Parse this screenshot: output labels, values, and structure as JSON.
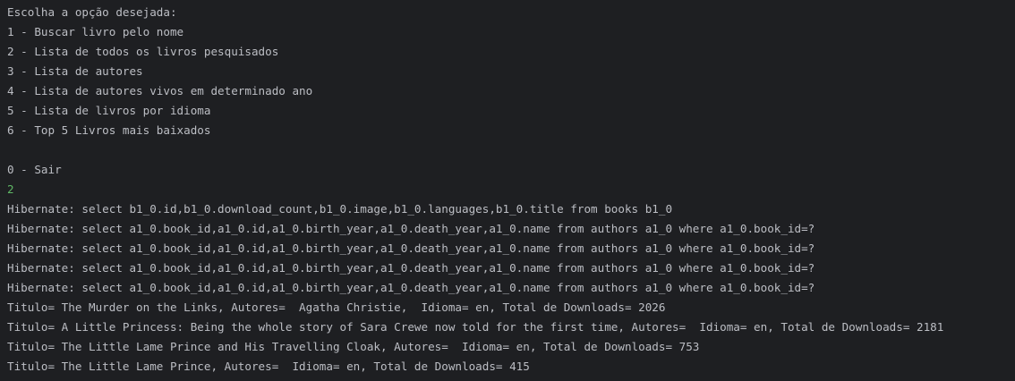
{
  "console": {
    "lines": [
      {
        "text": "Escolha a opção desejada:",
        "kind": "output"
      },
      {
        "text": "1 - Buscar livro pelo nome",
        "kind": "output"
      },
      {
        "text": "2 - Lista de todos os livros pesquisados",
        "kind": "output"
      },
      {
        "text": "3 - Lista de autores",
        "kind": "output"
      },
      {
        "text": "4 - Lista de autores vivos em determinado ano",
        "kind": "output"
      },
      {
        "text": "5 - Lista de livros por idioma",
        "kind": "output"
      },
      {
        "text": "6 - Top 5 Livros mais baixados",
        "kind": "output"
      },
      {
        "text": "",
        "kind": "output"
      },
      {
        "text": "0 - Sair",
        "kind": "output"
      },
      {
        "text": "2",
        "kind": "input"
      },
      {
        "text": "Hibernate: select b1_0.id,b1_0.download_count,b1_0.image,b1_0.languages,b1_0.title from books b1_0",
        "kind": "output"
      },
      {
        "text": "Hibernate: select a1_0.book_id,a1_0.id,a1_0.birth_year,a1_0.death_year,a1_0.name from authors a1_0 where a1_0.book_id=?",
        "kind": "output"
      },
      {
        "text": "Hibernate: select a1_0.book_id,a1_0.id,a1_0.birth_year,a1_0.death_year,a1_0.name from authors a1_0 where a1_0.book_id=?",
        "kind": "output"
      },
      {
        "text": "Hibernate: select a1_0.book_id,a1_0.id,a1_0.birth_year,a1_0.death_year,a1_0.name from authors a1_0 where a1_0.book_id=?",
        "kind": "output"
      },
      {
        "text": "Hibernate: select a1_0.book_id,a1_0.id,a1_0.birth_year,a1_0.death_year,a1_0.name from authors a1_0 where a1_0.book_id=?",
        "kind": "output"
      },
      {
        "text": "Titulo= The Murder on the Links, Autores=  Agatha Christie,  Idioma= en, Total de Downloads= 2026",
        "kind": "output"
      },
      {
        "text": "Titulo= A Little Princess: Being the whole story of Sara Crewe now told for the first time, Autores=  Idioma= en, Total de Downloads= 2181",
        "kind": "output"
      },
      {
        "text": "Titulo= The Little Lame Prince and His Travelling Cloak, Autores=  Idioma= en, Total de Downloads= 753",
        "kind": "output"
      },
      {
        "text": "Titulo= The Little Lame Prince, Autores=  Idioma= en, Total de Downloads= 415",
        "kind": "output"
      }
    ]
  },
  "colors": {
    "background": "#1e1f22",
    "output_text": "#bcbec4",
    "input_text": "#5fb865"
  }
}
